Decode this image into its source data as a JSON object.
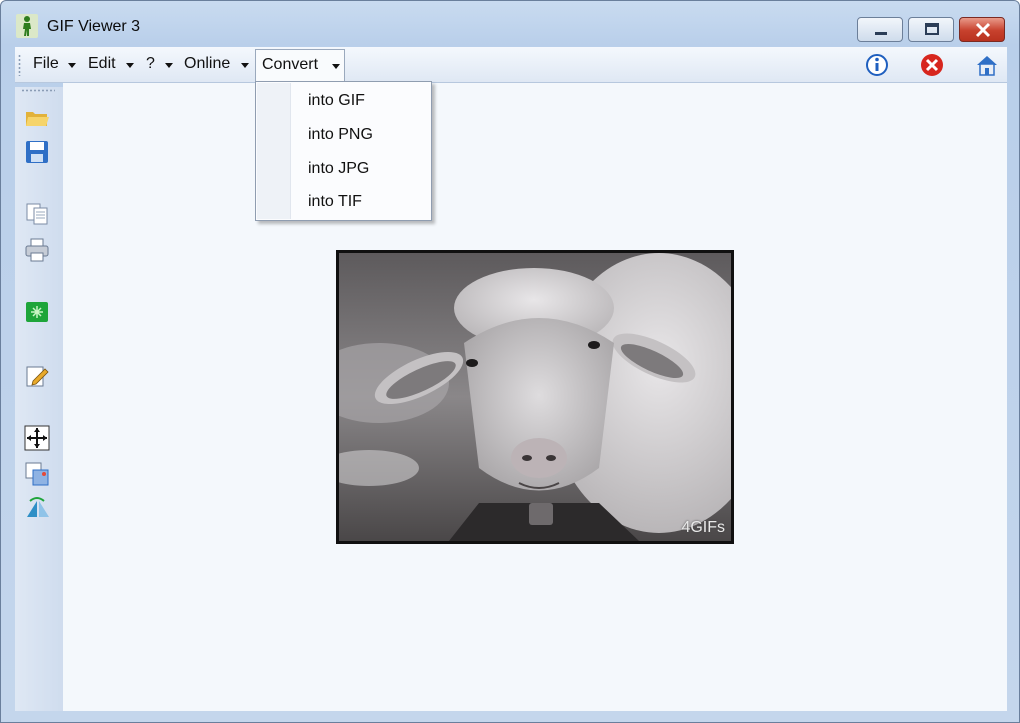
{
  "window": {
    "title": "GIF Viewer 3",
    "colors": {
      "titlebar": "#c9dbf0",
      "close_button": "#c7412d",
      "content_bg": "#f4f8fc"
    }
  },
  "menubar": {
    "file": "File",
    "edit": "Edit",
    "help": "?",
    "online": "Online",
    "convert": "Convert"
  },
  "toolbar_right": {
    "icons": [
      "info-icon",
      "exit-icon",
      "home-icon"
    ]
  },
  "left_toolbar": {
    "icons": [
      "open-folder-icon",
      "save-icon",
      "copy-icon",
      "print-icon",
      "resize-icon",
      "edit-icon",
      "move-icon",
      "convert-image-icon",
      "flip-icon"
    ]
  },
  "convert_menu": {
    "items": [
      "into GIF",
      "into PNG",
      "into JPG",
      "into TIF"
    ]
  },
  "image": {
    "description_icon": "sheep-gif",
    "watermark": "4GIFs"
  }
}
